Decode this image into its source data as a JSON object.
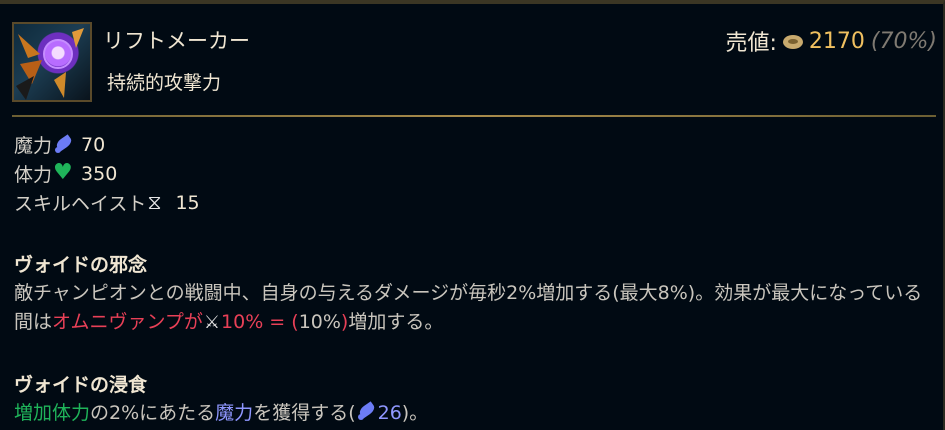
{
  "item": {
    "name": "リフトメーカー",
    "subtitle": "持続的攻撃力",
    "icon": "riftmaker-item-icon"
  },
  "sell": {
    "label": "売値:",
    "amount": "2170",
    "percent": "(70%)"
  },
  "stats": [
    {
      "label": "魔力",
      "icon": "ability-power-icon",
      "value": "70"
    },
    {
      "label": "体力",
      "icon": "health-icon",
      "value": "350"
    },
    {
      "label": "スキルヘイスト",
      "icon": "ability-haste-icon",
      "value": "15"
    }
  ],
  "passive1": {
    "title": "ヴォイドの邪念",
    "text_a": "敵チャンピオンとの戦闘中、自身の与えるダメージが毎秒2%増加する(最大8%)。効果が最大になっている間は",
    "red_a": "オムニヴァンプが",
    "red_b": "10% = (",
    "ratio": "10%",
    "red_c": ")",
    "text_b": "増加する。"
  },
  "passive2": {
    "title": "ヴォイドの浸食",
    "hp_text": "増加体力",
    "text_a": "の2%にあたる",
    "ap_text": "魔力",
    "text_b": "を獲得する(",
    "ap_value": "26",
    "text_c": ")。"
  },
  "colors": {
    "background": "#010a13",
    "text": "#f0e6d2",
    "gold": "#f0c060",
    "divider": "#a88b4b",
    "ap_blue": "#8f97ff",
    "health_green": "#1fb45a",
    "omnivamp_red": "#e84057"
  }
}
